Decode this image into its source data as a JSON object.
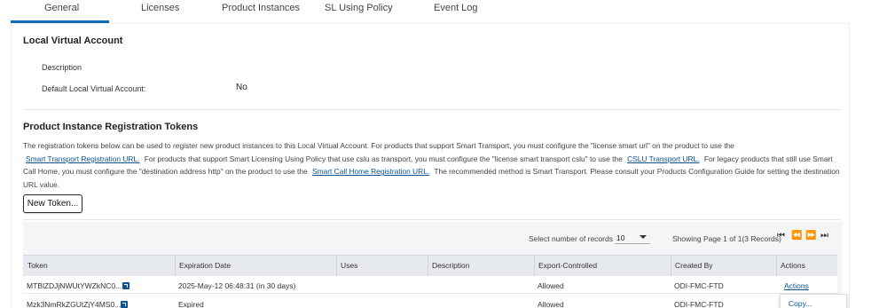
{
  "tabs": [
    "General",
    "Licenses",
    "Product Instances",
    "SL Using Policy",
    "Event Log"
  ],
  "active_tab": "General",
  "local_virtual_account": {
    "title": "Local Virtual Account",
    "description_label": "Description",
    "default_label": "Default Local Virtual Account:",
    "default_value": "No"
  },
  "tokens_section": {
    "title": "Product Instance Registration Tokens",
    "text_1": "The registration tokens below can be used to register new product instances to this Local Virtual Account. For products that support Smart Transport, you must configure the \"license smart url\" on the product to use the",
    "link_1": "Smart Transport Registration URL.",
    "text_2": "For products that support Smart Licensing Using Policy that use cslu as transport, you must configure the \"license smart transport cslu\" to use the",
    "link_2": "CSLU Transport URL.",
    "text_3": "For legacy products that still use Smart Call Home, you must configure the \"destination address http\" on the product to use the",
    "link_3": "Smart Call Home Registration URL.",
    "text_4": "The recommended method is Smart Transport. Please consult your Products Configuration Guide for setting the destination URL value.",
    "new_token_label": "New Token..."
  },
  "table_controls": {
    "records_label": "Select number of records",
    "records_value": "10",
    "paging_text": "Showing Page 1 of 1(3 Records)",
    "pager_icons": [
      "first-page-icon",
      "prev-page-icon",
      "next-page-icon",
      "last-page-icon"
    ]
  },
  "table": {
    "columns": [
      "Token",
      "Expiration Date",
      "Uses",
      "Description",
      "Export-Controlled",
      "Created By",
      "Actions"
    ],
    "rows": [
      {
        "token": "MTBlZDJjNWUtYWZkNC0...",
        "expiration": "2025-May-12 06:48:31 (in 30 days)",
        "uses": "",
        "description": "",
        "export": "Allowed",
        "created_by": "ODI-FMC-FTD",
        "actions": "Actions"
      },
      {
        "token": "Mzk3NmRkZGUtZjY4MS0...",
        "expiration": "Expired",
        "uses": "",
        "description": "",
        "export": "Allowed",
        "created_by": "ODI-FMC-FTD",
        "actions": ""
      }
    ]
  },
  "actions_menu": {
    "items": [
      "Copy..."
    ]
  },
  "colors": {
    "accent": "#0b6cb8",
    "link": "#0b5394",
    "header_bg": "#e6e9ed"
  }
}
